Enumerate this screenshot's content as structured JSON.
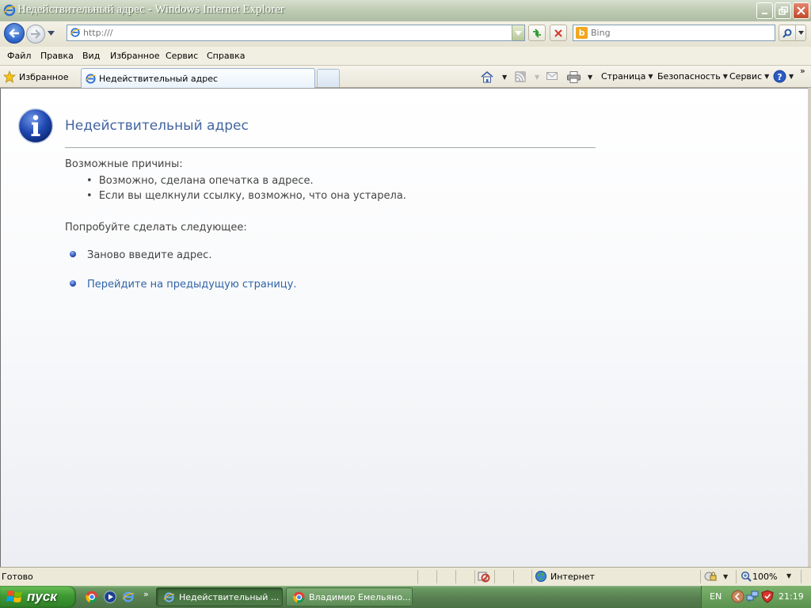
{
  "window": {
    "title": "Недействительный адрес - Windows Internet Explorer"
  },
  "navbar": {
    "address_value": "",
    "address_placeholder": "http:///",
    "search_placeholder": "Bing"
  },
  "menu": {
    "items": [
      "Файл",
      "Правка",
      "Вид",
      "Избранное",
      "Сервис",
      "Справка"
    ]
  },
  "tabs": {
    "favorites_label": "Избранное",
    "active_tab_label": "Недействительный адрес"
  },
  "commandbar": {
    "page_label": "Страница",
    "safety_label": "Безопасность",
    "tools_label": "Сервис"
  },
  "content": {
    "title": "Недействительный адрес",
    "causes_heading": "Возможные причины:",
    "causes": [
      "Возможно, сделана опечатка в адресе.",
      "Если вы щелкнули ссылку, возможно, что она устарела."
    ],
    "try_heading": "Попробуйте сделать следующее:",
    "actions": [
      "Заново введите адрес.",
      "Перейдите на предыдущую страницу."
    ]
  },
  "statusbar": {
    "status": "Готово",
    "zone": "Интернет",
    "zoom": "100%"
  },
  "taskbar": {
    "start_label": "пуск",
    "tasks": [
      "Недействительный ...",
      "Владимир Емельяно..."
    ],
    "language": "EN",
    "clock": "21:19"
  },
  "colors": {
    "title_blue": "#4465a2",
    "link_blue": "#2f64a8",
    "taskbar_green": "#577f50"
  }
}
